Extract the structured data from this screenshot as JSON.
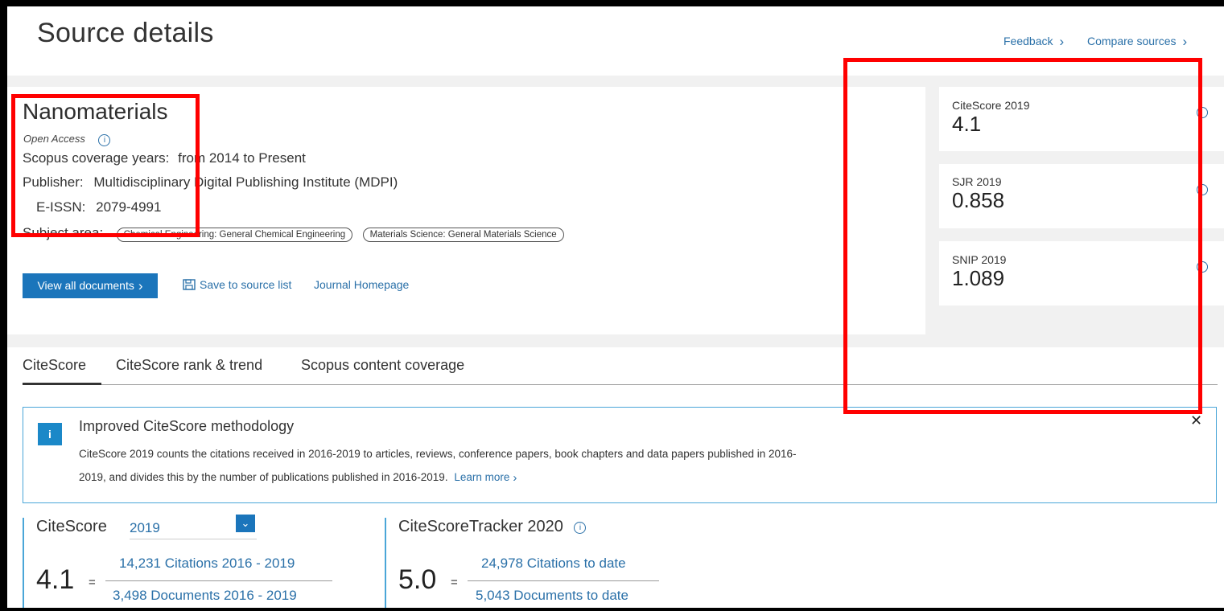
{
  "page": {
    "title": "Source details",
    "feedback_label": "Feedback",
    "compare_label": "Compare sources"
  },
  "journal": {
    "title": "Nanomaterials",
    "open_access": "Open Access",
    "coverage_label": "Scopus coverage years:",
    "coverage_value": "from 2014 to Present",
    "publisher_label": "Publisher:",
    "publisher_value": "Multidisciplinary Digital Publishing Institute (MDPI)",
    "eissn_label": "E-ISSN:",
    "eissn_value": "2079-4991",
    "subject_label": "Subject area:",
    "subjects": [
      "Chemical Engineering: General Chemical Engineering",
      "Materials Science: General Materials Science"
    ]
  },
  "actions": {
    "view_all": "View all documents",
    "save_to_list": "Save to source list",
    "journal_homepage": "Journal Homepage"
  },
  "metrics": [
    {
      "label": "CiteScore 2019",
      "value": "4.1"
    },
    {
      "label": "SJR 2019",
      "value": "0.858"
    },
    {
      "label": "SNIP 2019",
      "value": "1.089"
    }
  ],
  "tabs": [
    "CiteScore",
    "CiteScore rank & trend",
    "Scopus content coverage"
  ],
  "notice": {
    "icon": "i",
    "title": "Improved CiteScore methodology",
    "body": "CiteScore 2019 counts the citations received in 2016-2019 to articles, reviews, conference papers, book chapters and data papers published in 2016-2019, and divides this by the number of publications published in 2016-2019.",
    "learn_more": "Learn more"
  },
  "citescore": {
    "heading": "CiteScore",
    "year": "2019",
    "value": "4.1",
    "equals": "=",
    "citations": "14,231 Citations 2016 - 2019",
    "documents": "3,498 Documents 2016 - 2019"
  },
  "tracker": {
    "heading": "CiteScoreTracker 2020",
    "value": "5.0",
    "equals": "=",
    "citations": "24,978 Citations to date",
    "documents": "5,043 Documents to date"
  },
  "colors": {
    "link": "#2a70a8",
    "primary": "#1b75bb",
    "highlight": "#ff0000",
    "notice_border": "#4aa6d8"
  }
}
